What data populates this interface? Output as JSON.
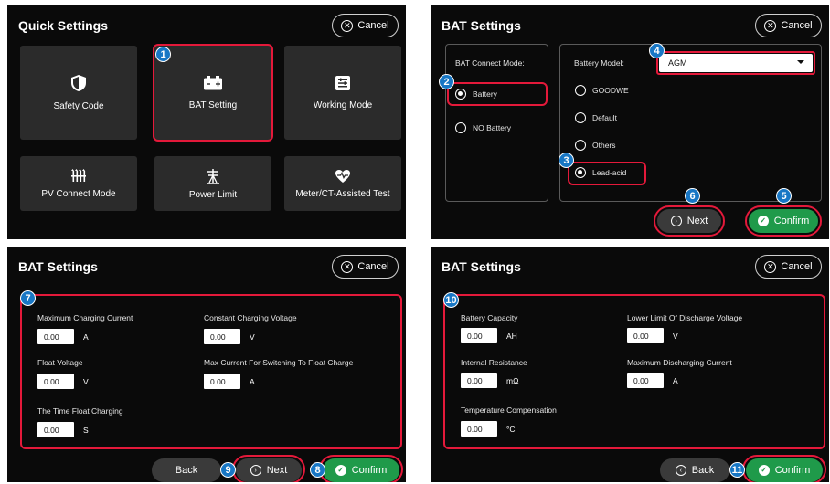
{
  "panel1": {
    "title": "Quick Settings",
    "cancel": "Cancel",
    "tiles": [
      {
        "label": "Safety Code",
        "icon": "shield-icon"
      },
      {
        "label": "BAT Setting",
        "icon": "battery-icon"
      },
      {
        "label": "Working Mode",
        "icon": "list-icon"
      },
      {
        "label": "PV Connect Mode",
        "icon": "pv-connect-icon"
      },
      {
        "label": "Power Limit",
        "icon": "power-limit-icon"
      },
      {
        "label": "Meter/CT-Assisted Test",
        "icon": "heart-pulse-icon"
      }
    ],
    "badge": "1"
  },
  "panel2": {
    "title": "BAT Settings",
    "cancel": "Cancel",
    "connect_mode_label": "BAT Connect Mode:",
    "connect_options": [
      {
        "label": "Battery",
        "selected": true
      },
      {
        "label": "NO Battery",
        "selected": false
      }
    ],
    "model_label": "Battery Model:",
    "model_value": "AGM",
    "model_options": [
      {
        "label": "GOODWE",
        "selected": false
      },
      {
        "label": "Default",
        "selected": false
      },
      {
        "label": "Others",
        "selected": false
      },
      {
        "label": "Lead-acid",
        "selected": true
      }
    ],
    "next": "Next",
    "confirm": "Confirm",
    "badges": [
      "2",
      "3",
      "4",
      "5",
      "6"
    ]
  },
  "panel3": {
    "title": "BAT Settings",
    "cancel": "Cancel",
    "fields": [
      {
        "label": "Maximum Charging Current",
        "value": "0.00",
        "unit": "A"
      },
      {
        "label": "Constant Charging Voltage",
        "value": "0.00",
        "unit": "V"
      },
      {
        "label": "Float Voltage",
        "value": "0.00",
        "unit": "V"
      },
      {
        "label": "Max Current For Switching To Float Charge",
        "value": "0.00",
        "unit": "A"
      },
      {
        "label": "The Time Float Charging",
        "value": "0.00",
        "unit": "S"
      }
    ],
    "back": "Back",
    "next": "Next",
    "confirm": "Confirm",
    "badges": [
      "7",
      "8",
      "9"
    ]
  },
  "panel4": {
    "title": "BAT Settings",
    "cancel": "Cancel",
    "fields": [
      {
        "label": "Battery Capacity",
        "value": "0.00",
        "unit": "AH"
      },
      {
        "label": "Lower Limit Of Discharge Voltage",
        "value": "0.00",
        "unit": "V"
      },
      {
        "label": "Internal Resistance",
        "value": "0.00",
        "unit": "mΩ"
      },
      {
        "label": "Maximum Discharging Current",
        "value": "0.00",
        "unit": "A"
      },
      {
        "label": "Temperature  Compensation",
        "value": "0.00",
        "unit": "°C"
      }
    ],
    "back": "Back",
    "confirm": "Confirm",
    "badges": [
      "10",
      "11"
    ]
  },
  "colors": {
    "panel_bg": "#0a0a0a",
    "tile_bg": "#2b2b2b",
    "highlight": "#e4193a",
    "badge": "#1877c5",
    "confirm_green": "#1f9a4a"
  }
}
